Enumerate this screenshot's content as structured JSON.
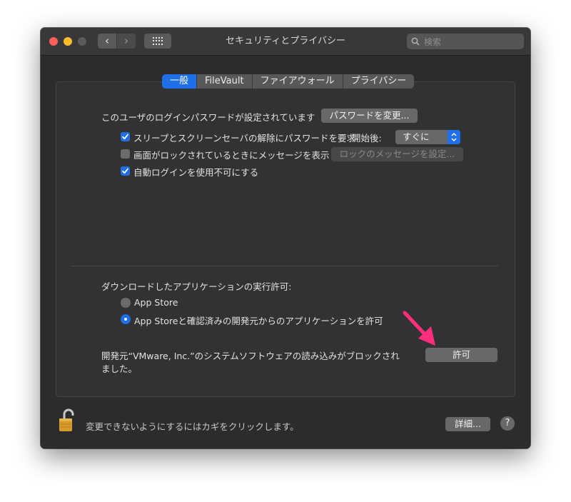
{
  "window": {
    "title": "セキュリティとプライバシー",
    "back_glyph": "‹",
    "forward_glyph": "›",
    "search_placeholder": "検索"
  },
  "tabs": [
    {
      "label": "一般",
      "active": true
    },
    {
      "label": "FileVault",
      "active": false
    },
    {
      "label": "ファイアウォール",
      "active": false
    },
    {
      "label": "プライバシー",
      "active": false
    }
  ],
  "general": {
    "password_status": "このユーザのログインパスワードが設定されています",
    "change_password_button": "パスワードを変更...",
    "require_password": {
      "label": "スリープとスクリーンセーバの解除にパスワードを要求",
      "checked": true,
      "after_label": "開始後:",
      "after_value": "すぐに"
    },
    "show_message": {
      "label": "画面がロックされているときにメッセージを表示",
      "checked": false,
      "button": "ロックのメッセージを設定..."
    },
    "disable_autologin": {
      "label": "自動ログインを使用不可にする",
      "checked": true
    }
  },
  "downloads": {
    "heading": "ダウンロードしたアプリケーションの実行許可:",
    "options": [
      {
        "label": "App Store",
        "selected": false
      },
      {
        "label": "App Storeと確認済みの開発元からのアプリケーションを許可",
        "selected": true
      }
    ],
    "blocked_message_line1": "開発元“VMware, Inc.”のシステムソフトウェアの読み込みがブロックされ",
    "blocked_message_line2": "ました。",
    "allow_button": "許可"
  },
  "footer": {
    "lock_message": "変更できないようにするにはカギをクリックします。",
    "advanced_button": "詳細...",
    "help_glyph": "?"
  },
  "colors": {
    "accent": "#1e6fe8",
    "annotation_arrow": "#ff2f7d"
  },
  "icons": [
    "back-chevron-icon",
    "forward-chevron-icon",
    "grid-icon",
    "search-icon",
    "checkmark-icon",
    "select-arrows-icon",
    "lock-icon",
    "annotation-arrow"
  ]
}
